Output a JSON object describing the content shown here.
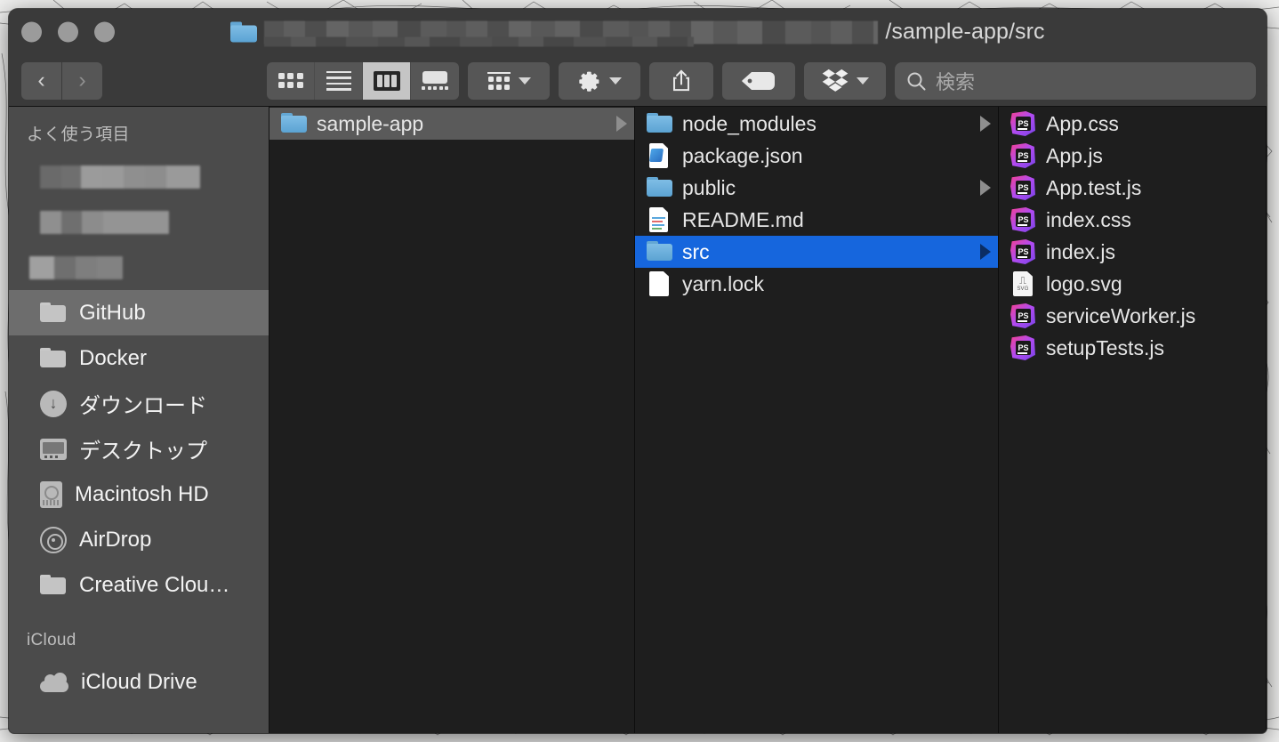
{
  "window": {
    "title_path": "/sample-app/src",
    "title_folder_icon": "blue-folder-icon",
    "redacted_path_prefix": true,
    "traffic_lights": [
      "close-button",
      "minimize-button",
      "zoom-button"
    ]
  },
  "toolbar": {
    "back_label": "‹",
    "forward_label": "›",
    "view_modes": [
      {
        "name": "icon-view",
        "label": "icon",
        "active": false
      },
      {
        "name": "list-view",
        "label": "list",
        "active": false
      },
      {
        "name": "column-view",
        "label": "column",
        "active": true
      },
      {
        "name": "gallery-view",
        "label": "gallery",
        "active": false
      }
    ],
    "arrange_button": "arrange-icon",
    "action_button": "gear-icon",
    "share_button": "share-icon",
    "tag_button": "tag-icon",
    "dropbox_button": "dropbox-icon",
    "chevron_label": "⌄"
  },
  "search": {
    "placeholder": "検索",
    "value": "",
    "icon": "search-icon"
  },
  "sidebar": {
    "sections": [
      {
        "header": "よく使う項目",
        "items": [
          {
            "label": "",
            "icon": "redacted",
            "redacted": true,
            "selected": false
          },
          {
            "label": "",
            "icon": "redacted",
            "redacted": true,
            "selected": false
          },
          {
            "label": "",
            "icon": "redacted",
            "redacted": true,
            "selected": false
          },
          {
            "label": "GitHub",
            "icon": "folder-icon",
            "selected": true
          },
          {
            "label": "Docker",
            "icon": "folder-icon",
            "selected": false
          },
          {
            "label": "ダウンロード",
            "icon": "downloads-icon",
            "selected": false
          },
          {
            "label": "デスクトップ",
            "icon": "desktop-icon",
            "selected": false
          },
          {
            "label": "Macintosh HD",
            "icon": "harddisk-icon",
            "selected": false
          },
          {
            "label": "AirDrop",
            "icon": "airdrop-icon",
            "selected": false
          },
          {
            "label": "Creative Clou…",
            "icon": "folder-icon",
            "selected": false
          }
        ]
      },
      {
        "header": "iCloud",
        "items": [
          {
            "label": "iCloud Drive",
            "icon": "cloud-icon",
            "selected": false
          }
        ]
      }
    ]
  },
  "columns": [
    {
      "name": "column-1",
      "rows": [
        {
          "label": "sample-app",
          "icon": "blue-folder-icon",
          "selected": "grey",
          "disclosure": true
        }
      ]
    },
    {
      "name": "column-2",
      "rows": [
        {
          "label": "node_modules",
          "icon": "blue-folder-icon",
          "selected": "none",
          "disclosure": true
        },
        {
          "label": "package.json",
          "icon": "json-file-icon",
          "selected": "none",
          "disclosure": false
        },
        {
          "label": "public",
          "icon": "blue-folder-icon",
          "selected": "none",
          "disclosure": true
        },
        {
          "label": "README.md",
          "icon": "markdown-file-icon",
          "selected": "none",
          "disclosure": false
        },
        {
          "label": "src",
          "icon": "blue-folder-icon",
          "selected": "blue",
          "disclosure": true
        },
        {
          "label": "yarn.lock",
          "icon": "plain-file-icon",
          "selected": "none",
          "disclosure": false
        }
      ]
    },
    {
      "name": "column-3",
      "rows": [
        {
          "label": "App.css",
          "icon": "phpstorm-file-icon",
          "selected": "none",
          "disclosure": false
        },
        {
          "label": "App.js",
          "icon": "phpstorm-file-icon",
          "selected": "none",
          "disclosure": false
        },
        {
          "label": "App.test.js",
          "icon": "phpstorm-file-icon",
          "selected": "none",
          "disclosure": false
        },
        {
          "label": "index.css",
          "icon": "phpstorm-file-icon",
          "selected": "none",
          "disclosure": false
        },
        {
          "label": "index.js",
          "icon": "phpstorm-file-icon",
          "selected": "none",
          "disclosure": false
        },
        {
          "label": "logo.svg",
          "icon": "svg-file-icon",
          "selected": "none",
          "disclosure": false
        },
        {
          "label": "serviceWorker.js",
          "icon": "phpstorm-file-icon",
          "selected": "none",
          "disclosure": false
        },
        {
          "label": "setupTests.js",
          "icon": "phpstorm-file-icon",
          "selected": "none",
          "disclosure": false
        }
      ]
    }
  ],
  "colors": {
    "selection_blue": "#1666dd",
    "selection_grey": "#5a5a5a",
    "window_chrome": "#3a3a3a",
    "sidebar_bg": "#4b4b4b",
    "column_bg": "#1e1e1e",
    "folder_blue": "#63a7d4"
  },
  "icon_glyphs": {
    "ps_label": "PS",
    "svg_label": "SVG",
    "svg_glyph": "⎍"
  }
}
